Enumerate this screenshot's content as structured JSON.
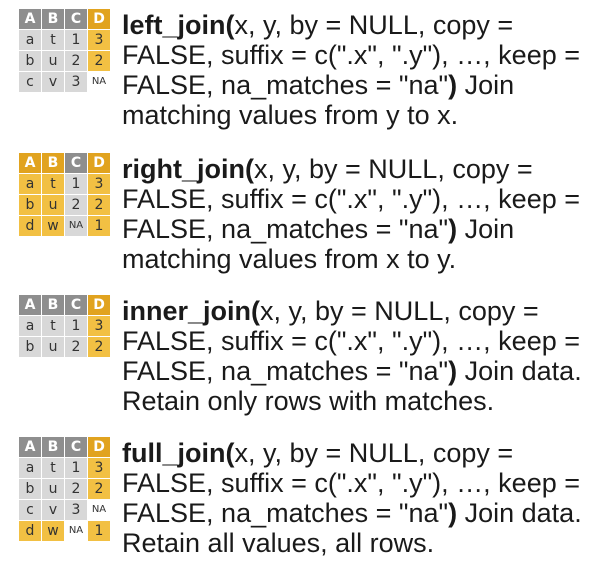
{
  "header_letters": [
    "A",
    "B",
    "C",
    "D"
  ],
  "functions": [
    {
      "name": "left_join",
      "open": "(",
      "args": "x, y, by = NULL, copy = FALSE, suffix = c(\".x\", \".y\"), …, keep = FALSE, na_matches = \"na\"",
      "close": ")",
      "description": " Join matching values from y to x.",
      "rows": [
        [
          "a",
          "t",
          "1",
          "3"
        ],
        [
          "b",
          "u",
          "2",
          "2"
        ],
        [
          "c",
          "v",
          "3",
          "NA"
        ]
      ]
    },
    {
      "name": "right_join",
      "open": "(",
      "args": "x, y, by = NULL, copy = FALSE, suffix = c(\".x\", \".y\"), …, keep = FALSE, na_matches = \"na\"",
      "close": ")",
      "description": " Join matching values from x to y.",
      "rows": [
        [
          "a",
          "t",
          "1",
          "3"
        ],
        [
          "b",
          "u",
          "2",
          "2"
        ],
        [
          "d",
          "w",
          "NA",
          "1"
        ]
      ]
    },
    {
      "name": "inner_join",
      "open": "(",
      "args": "x, y, by = NULL, copy = FALSE, suffix = c(\".x\", \".y\"), …, keep = FALSE, na_matches = \"na\"",
      "close": ")",
      "description": " Join data. Retain only rows with matches.",
      "rows": [
        [
          "a",
          "t",
          "1",
          "3"
        ],
        [
          "b",
          "u",
          "2",
          "2"
        ]
      ]
    },
    {
      "name": "full_join",
      "open": "(",
      "args": "x, y, by = NULL, copy = FALSE, suffix = c(\".x\", \".y\"), …, keep = FALSE, na_matches = \"na\"",
      "close": ")",
      "description": " Join data. Retain all values, all rows.",
      "rows": [
        [
          "a",
          "t",
          "1",
          "3"
        ],
        [
          "b",
          "u",
          "2",
          "2"
        ],
        [
          "c",
          "v",
          "3",
          "NA"
        ],
        [
          "d",
          "w",
          "NA",
          "1"
        ]
      ]
    }
  ],
  "colors": {
    "header_gray": "#8e8e8e",
    "header_gold": "#e1a31f",
    "cell_gray": "#d8d8d8",
    "cell_gold": "#f2c043"
  }
}
